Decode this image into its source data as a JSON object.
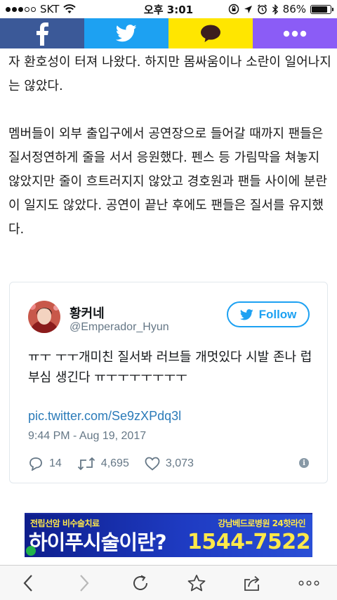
{
  "status_bar": {
    "carrier": "SKT",
    "time": "오후 3:01",
    "battery_percent": "86%",
    "battery_level": 0.86
  },
  "share_bar": {
    "buttons": [
      {
        "name": "facebook",
        "icon": "facebook-icon",
        "color": "#3b5998"
      },
      {
        "name": "twitter",
        "icon": "twitter-bird-icon",
        "color": "#1da1f2"
      },
      {
        "name": "kakaotalk",
        "icon": "speech-bubble-icon",
        "color": "#ffe600"
      },
      {
        "name": "more",
        "icon": "more-dots-icon",
        "color": "#8b5cf6"
      }
    ]
  },
  "article": {
    "paragraph_1": "자 환호성이 터져 나왔다. 하지만 몸싸움이나 소란이 일어나지는 않았다.",
    "paragraph_2": "멤버들이 외부 출입구에서 공연장으로 들어갈 때까지 팬들은 질서정연하게 줄을 서서 응원했다. 펜스 등 가림막을 쳐놓지 않았지만 줄이 흐트러지지 않았고 경호원과 팬들 사이에 분란이 일지도 않았다. 공연이 끝난 후에도 팬들은 질서를 유지했다."
  },
  "tweet": {
    "display_name": "황커네",
    "handle": "@Emperador_Hyun",
    "follow_label": "Follow",
    "text": "ㅠㅜ ㅜㅜ개미친 질서봐 러브들 개멋있다 시발 존나 럽부심 생긴다 ㅠㅜㅜㅜㅜㅜㅜㅜ",
    "link": "pic.twitter.com/Se9zXPdq3l",
    "timestamp": "9:44 PM - Aug 19, 2017",
    "replies": "14",
    "retweets": "4,695",
    "likes": "3,073"
  },
  "ad": {
    "top_left": "전립선암 비수술치료",
    "top_right": "강남베드로병원 24핫라인",
    "headline": "하이푸시술이란?",
    "phone": "1544-7522"
  },
  "toolbar": {
    "buttons": [
      "back-icon",
      "forward-icon",
      "reload-icon",
      "bookmark-star-icon",
      "share-icon",
      "more-icon"
    ]
  }
}
